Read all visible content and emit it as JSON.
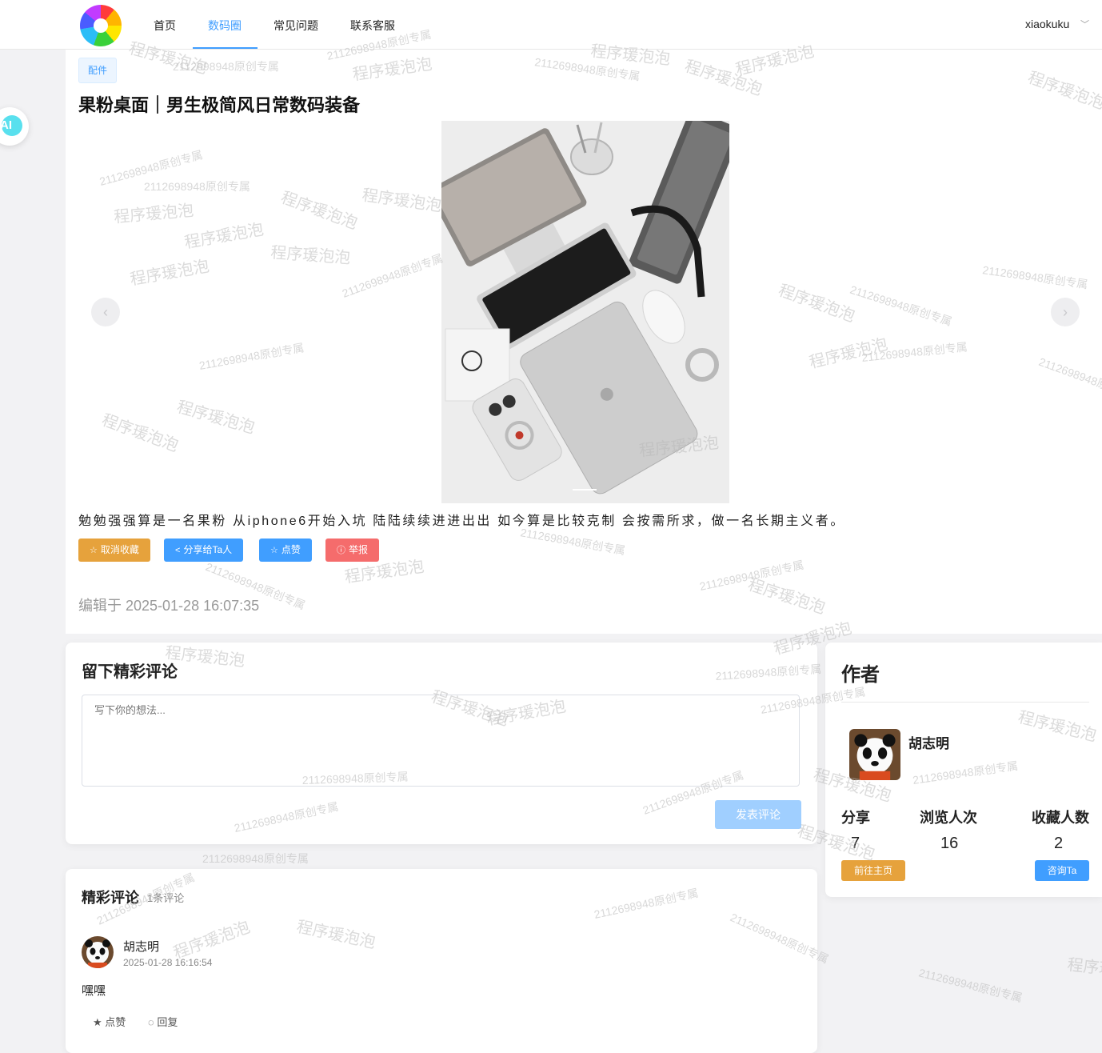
{
  "nav": {
    "items": [
      {
        "label": "首页"
      },
      {
        "label": "数码圈"
      },
      {
        "label": "常见问题"
      },
      {
        "label": "联系客服"
      }
    ],
    "active_index": 1,
    "username": "xiaokuku",
    "ai_label": "AI"
  },
  "post": {
    "tag": "配件",
    "title": "果粉桌面｜男生极简风日常数码装备",
    "description": "勉勉强强算是一名果粉 从iphone6开始入坑 陆陆续续进进出出 如今算是比较克制 会按需所求，做一名长期主义者。",
    "image_alt": "Apple desk setup: iMac, keyboard, iPad, iPhone, Magic Mouse",
    "actions": {
      "unfavorite": "取消收藏",
      "share": "分享给Ta人",
      "like": "点赞",
      "report": "举报"
    },
    "edited": "编辑于 2025-01-28 16:07:35"
  },
  "comment_form": {
    "title": "留下精彩评论",
    "placeholder": "写下你的想法...",
    "submit": "发表评论"
  },
  "comments": {
    "title": "精彩评论",
    "count": "1条评论",
    "items": [
      {
        "author": "胡志明",
        "time": "2025-01-28 16:16:54",
        "text": "嘿嘿",
        "like": "点赞",
        "reply": "回复"
      }
    ]
  },
  "author": {
    "title": "作者",
    "name": "胡志明",
    "stats": [
      {
        "label": "分享",
        "value": "7"
      },
      {
        "label": "浏览人次",
        "value": "16"
      },
      {
        "label": "收藏人数",
        "value": "2"
      }
    ],
    "home_button": "前往主页",
    "ask_button": "咨询Ta"
  },
  "colors": {
    "primary": "#409eff",
    "warning": "#e6a23c",
    "danger": "#f56c6c",
    "primary_light": "#a0cfff"
  },
  "watermark": {
    "text_a": "2112698948原创专属",
    "text_b": "程序瑗泡泡"
  }
}
